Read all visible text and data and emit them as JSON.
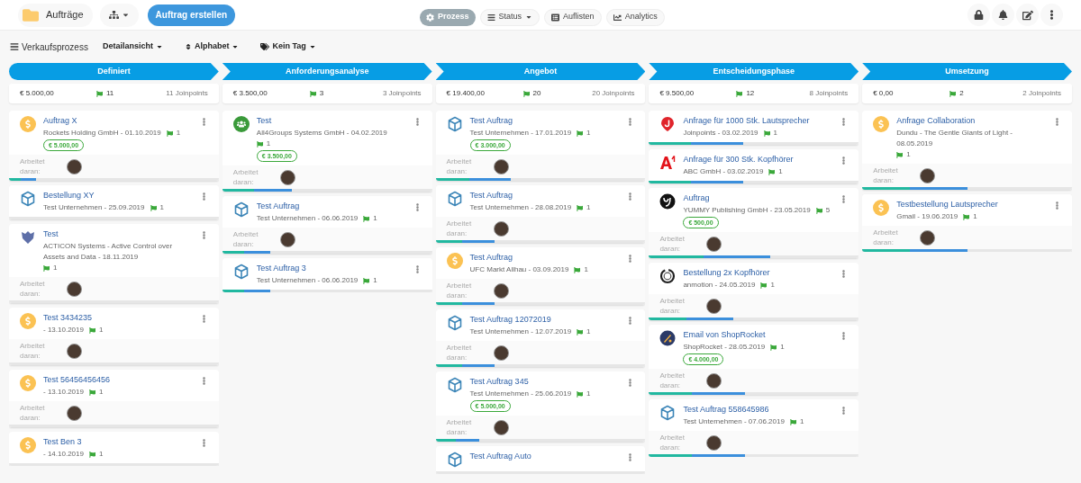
{
  "header": {
    "title": "Aufträge",
    "create_button": "Auftrag erstellen"
  },
  "view_tabs": [
    {
      "label": "Prozess",
      "kind": "gear",
      "selected": true,
      "dropdown": false
    },
    {
      "label": "Status",
      "kind": "bars",
      "selected": false,
      "dropdown": true
    },
    {
      "label": "Auflisten",
      "kind": "list",
      "selected": false,
      "dropdown": false
    },
    {
      "label": "Analytics",
      "kind": "chart",
      "selected": false,
      "dropdown": false
    }
  ],
  "toolbar": {
    "process": "Verkaufsprozess",
    "filters": [
      {
        "label": "Detailansicht",
        "kind": "plain"
      },
      {
        "label": "Alphabet",
        "kind": "sort"
      },
      {
        "label": "Kein Tag",
        "kind": "tags"
      }
    ]
  },
  "stages": [
    {
      "name": "Definiert",
      "amount": "€ 5.000,00",
      "flags": "11",
      "joinpoints": "11 Joinpoints",
      "cards": [
        {
          "kind": "dollar",
          "title": "Auftrag X",
          "subtitle": "Rockets Holding GmbH - 01.10.2019",
          "flags": "1",
          "amount": "€ 5.000,00",
          "assignee_label": "Arbeitet daran:",
          "level": 0.13
        },
        {
          "kind": "hexagon",
          "title": "Bestellung XY",
          "subtitle": "Test Unternehmen - 25.09.2019",
          "flags": "1",
          "level": 0
        },
        {
          "kind": "shield",
          "title": "Test",
          "subtitle": "ACTICON Systems - Active Control over Assets and Data - 18.11.2019",
          "flags": "1",
          "assignee_label": "Arbeitet daran:",
          "level": 0
        },
        {
          "kind": "dollar",
          "title": "Test 3434235",
          "subtitle": "- 13.10.2019",
          "flags": "1",
          "assignee_label": "Arbeitet daran:",
          "level": 0
        },
        {
          "kind": "dollar",
          "title": "Test 56456456456",
          "subtitle": "- 13.10.2019",
          "flags": "1",
          "assignee_label": "Arbeitet daran:",
          "level": 0
        },
        {
          "kind": "dollar",
          "title": "Test Ben 3",
          "subtitle": "- 14.10.2019",
          "flags": "1",
          "level": 0
        }
      ]
    },
    {
      "name": "Anforderungsanalyse",
      "amount": "€ 3.500,00",
      "flags": "3",
      "joinpoints": "3 Joinpoints",
      "cards": [
        {
          "kind": "group",
          "title": "Test",
          "subtitle": "All4Groups Systems GmbH - 04.02.2019",
          "flags": "1",
          "amount": "€ 3.500,00",
          "assignee_label": "Arbeitet daran:",
          "level": 0.33
        },
        {
          "kind": "hexagon",
          "title": "Test Auftrag",
          "subtitle": "Test Unternehmen - 06.06.2019",
          "flags": "1",
          "assignee_label": "Arbeitet daran:",
          "level": 0.23
        },
        {
          "kind": "hexagon",
          "title": "Test Auftrag 3",
          "subtitle": "Test Unternehmen - 06.06.2019",
          "flags": "1",
          "level": 0.23
        }
      ]
    },
    {
      "name": "Angebot",
      "amount": "€ 19.400,00",
      "flags": "20",
      "joinpoints": "20 Joinpoints",
      "cards": [
        {
          "kind": "hexagon",
          "title": "Test Auftrag",
          "subtitle": "Test Unternehmen - 17.01.2019",
          "flags": "1",
          "amount": "€ 3.000,00",
          "assignee_label": "Arbeitet daran:",
          "level": 0.36
        },
        {
          "kind": "hexagon",
          "title": "Test Auftrag",
          "subtitle": "Test Unternehmen - 28.08.2019",
          "flags": "1",
          "assignee_label": "Arbeitet daran:",
          "level": 0.28
        },
        {
          "kind": "dollar",
          "title": "Test Auftrag",
          "subtitle": "UFC Markt Allhau - 03.09.2019",
          "flags": "1",
          "assignee_label": "Arbeitet daran:",
          "level": 0.28
        },
        {
          "kind": "hexagon",
          "title": "Test Auftrag 12072019",
          "subtitle": "Test Unternehmen - 12.07.2019",
          "flags": "1",
          "assignee_label": "Arbeitet daran:",
          "level": 0.28
        },
        {
          "kind": "hexagon",
          "title": "Test Auftrag 345",
          "subtitle": "Test Unternehmen - 25.06.2019",
          "flags": "1",
          "amount": "€ 5.000,00",
          "assignee_label": "Arbeitet daran:",
          "level": 0.21
        },
        {
          "kind": "hexagon",
          "title": "Test Auftrag Auto",
          "level": 0
        }
      ]
    },
    {
      "name": "Entscheidungsphase",
      "amount": "€ 9.500,00",
      "flags": "12",
      "joinpoints": "8 Joinpoints",
      "cards": [
        {
          "kind": "jletter",
          "title": "Anfrage für 1000 Stk. Lautsprecher",
          "subtitle": "Joinpoints - 03.02.2019",
          "flags": "1",
          "level": 0.45
        },
        {
          "kind": "a1",
          "title": "Anfrage für 300 Stk. Kopfhörer",
          "subtitle": "ABC GmbH - 03.02.2019",
          "flags": "1",
          "level": 0.45
        },
        {
          "kind": "yletter",
          "title": "Auftrag",
          "subtitle": "YUMMY Publishing GmbH - 23.05.2019",
          "flags": "5",
          "amount": "€ 500,00",
          "assignee_label": "Arbeitet daran:",
          "level": 0.58
        },
        {
          "kind": "ring",
          "title": "Bestellung 2x Kopfhörer",
          "subtitle": "anmotion - 24.05.2019",
          "flags": "1",
          "assignee_label": "Arbeitet daran:",
          "level": 0.4
        },
        {
          "kind": "rocket",
          "title": "Email von ShopRocket",
          "subtitle": "ShopRocket - 28.05.2019",
          "flags": "1",
          "amount": "€ 4.000,00",
          "assignee_label": "Arbeitet daran:",
          "level": 0.46
        },
        {
          "kind": "hexagon",
          "title": "Test Auftrag 558645986",
          "subtitle": "Test Unternehmen - 07.06.2019",
          "flags": "1",
          "assignee_label": "Arbeitet daran:",
          "level": 0.46
        }
      ]
    },
    {
      "name": "Umsetzung",
      "amount": "€ 0,00",
      "flags": "2",
      "joinpoints": "2 Joinpoints",
      "cards": [
        {
          "kind": "dollar",
          "title": "Anfrage Collaboration",
          "subtitle": "Dundu - The Gentle Giants of Light - 08.05.2019",
          "flags": "1",
          "assignee_label": "Arbeitet daran:",
          "level": 0.5
        },
        {
          "kind": "dollar",
          "title": "Testbestellung Lautsprecher",
          "subtitle": "Gmail - 19.06.2019",
          "flags": "1",
          "assignee_label": "Arbeitet daran:",
          "level": 0.5
        }
      ]
    }
  ]
}
